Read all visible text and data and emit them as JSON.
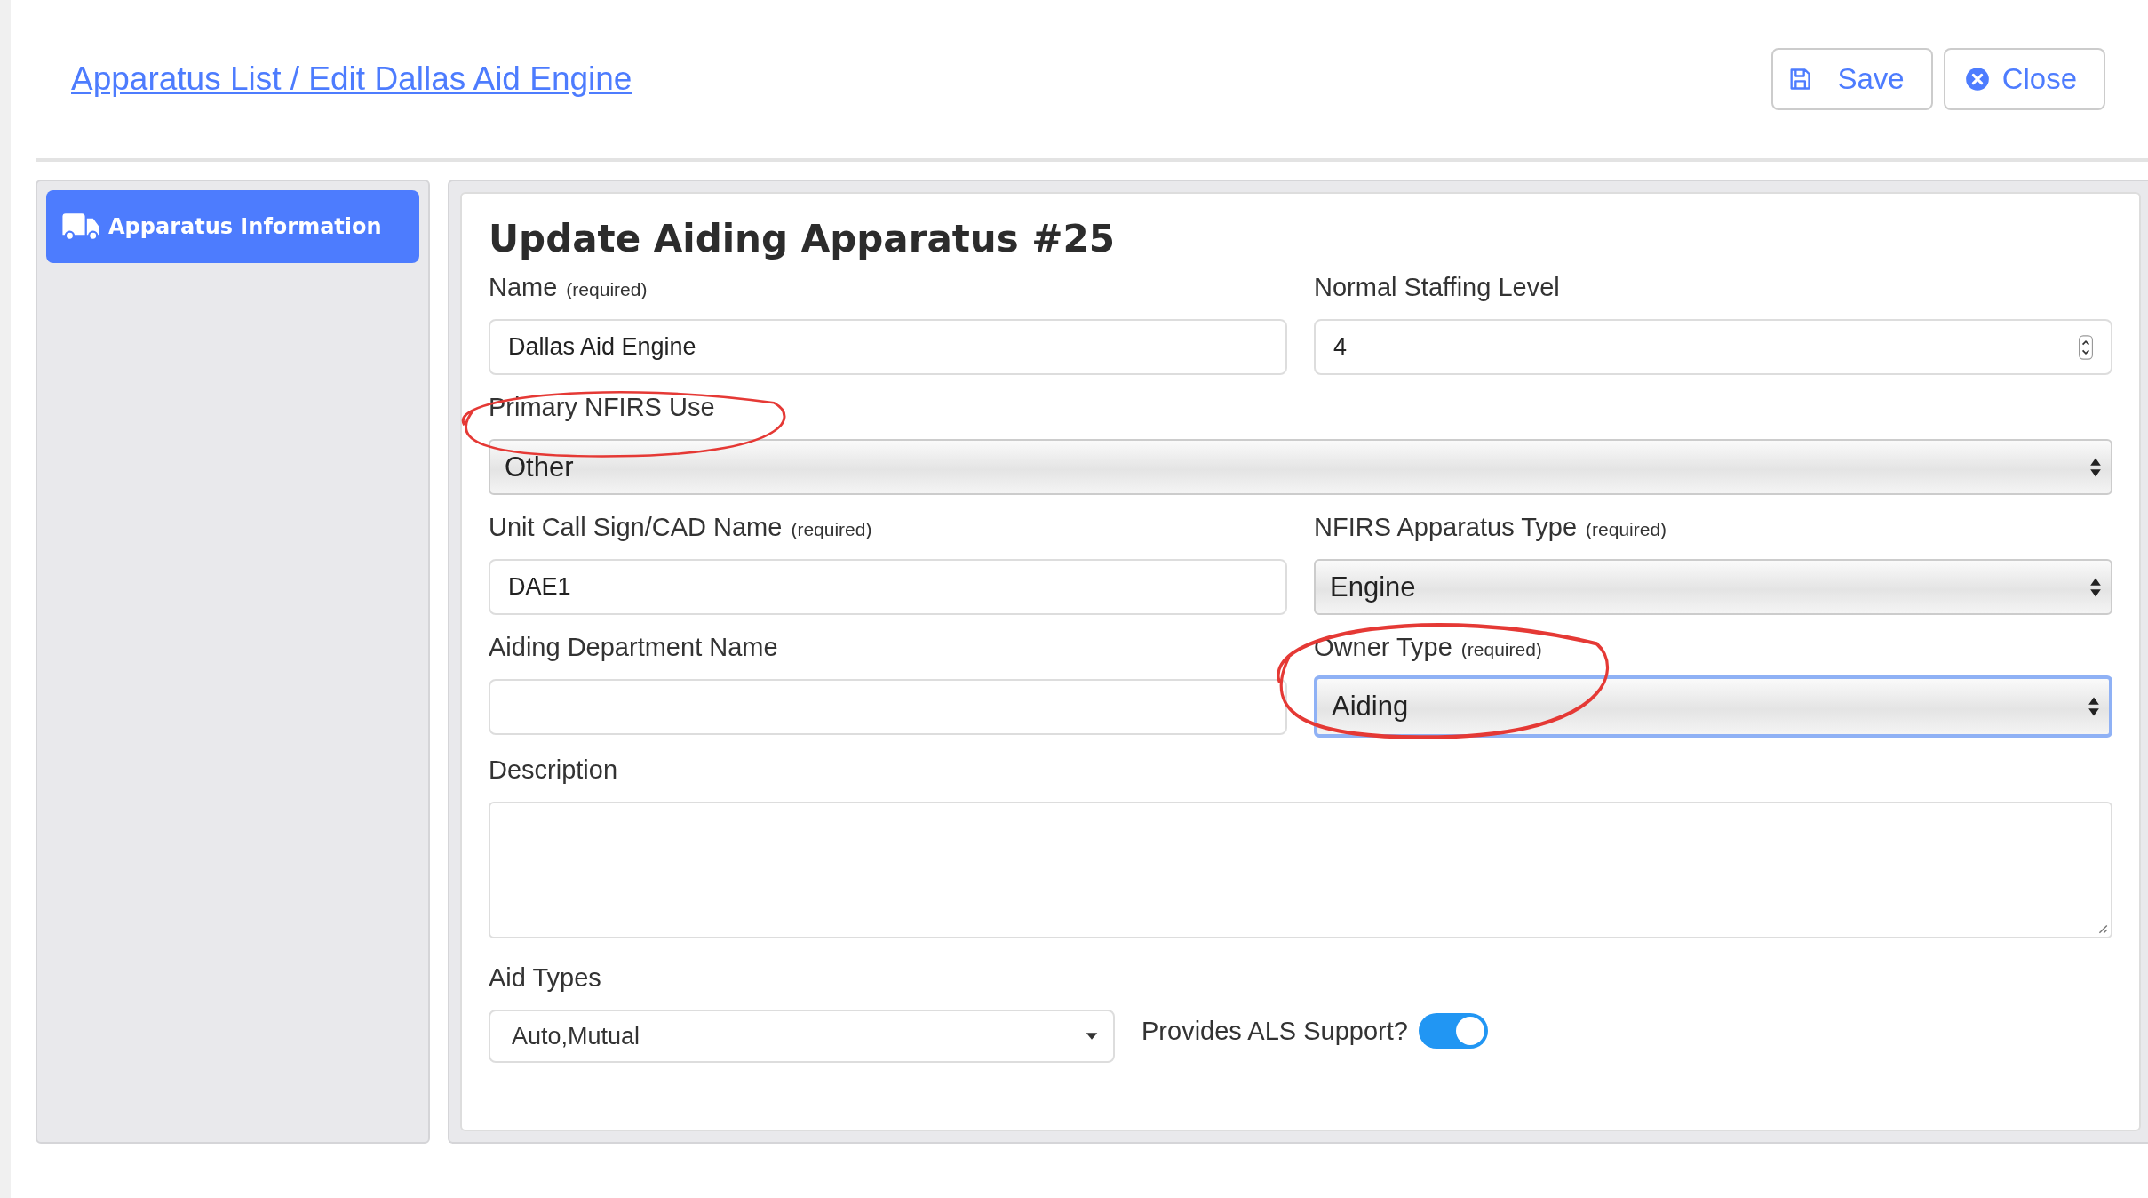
{
  "breadcrumb": "Apparatus List / Edit Dallas Aid Engine",
  "buttons": [
    {
      "kind": "save",
      "label": "Save"
    },
    {
      "kind": "close",
      "label": "Close"
    }
  ],
  "sidebar": {
    "items": [
      {
        "label": "Apparatus Information",
        "selected": true
      }
    ]
  },
  "form": {
    "title": "Update Aiding Apparatus #25",
    "rows": [
      [
        {
          "kind": "text",
          "label": "Name",
          "note": "(required)",
          "value": "Dallas Aid Engine"
        },
        {
          "kind": "number",
          "label": "Normal Staffing Level",
          "value": "4"
        }
      ],
      [
        {
          "kind": "select",
          "label": "Primary NFIRS Use",
          "value": "Other",
          "circled": true
        }
      ],
      [
        {
          "kind": "text",
          "label": "Unit Call Sign/CAD Name",
          "note": "(required)",
          "value": "DAE1"
        },
        {
          "kind": "select",
          "label": "NFIRS Apparatus Type",
          "note": "(required)",
          "value": "Engine"
        }
      ],
      [
        {
          "kind": "text",
          "label": "Aiding Department Name"
        },
        {
          "kind": "select",
          "label": "Owner Type",
          "note": "(required)",
          "value": "Aiding",
          "circled": true,
          "focused": true
        }
      ],
      [
        {
          "kind": "textarea",
          "label": "Description"
        }
      ]
    ],
    "aid_types": {
      "label": "Aid Types",
      "value": "Auto,Mutual"
    },
    "als_support": {
      "label": "Provides ALS Support?",
      "on": true
    }
  }
}
